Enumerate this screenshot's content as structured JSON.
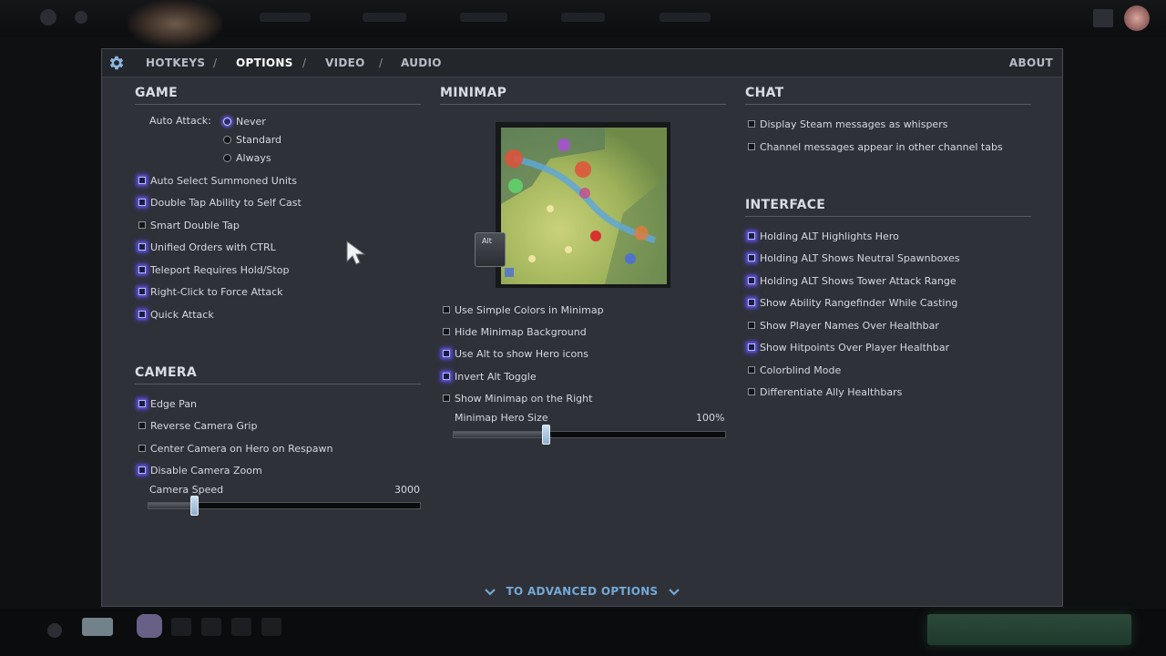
{
  "header": {
    "tabs": [
      {
        "label": "HOTKEYS",
        "active": false
      },
      {
        "label": "OPTIONS",
        "active": true
      },
      {
        "label": "VIDEO",
        "active": false
      },
      {
        "label": "AUDIO",
        "active": false
      }
    ],
    "separator": "/",
    "about_label": "ABOUT",
    "settings_icon": "gear-icon"
  },
  "game": {
    "title": "GAME",
    "auto_attack_label": "Auto Attack:",
    "auto_attack_options": [
      {
        "label": "Never",
        "selected": true
      },
      {
        "label": "Standard",
        "selected": false
      },
      {
        "label": "Always",
        "selected": false
      }
    ],
    "options": [
      {
        "label": "Auto Select Summoned Units",
        "checked": true
      },
      {
        "label": "Double Tap Ability to Self Cast",
        "checked": true
      },
      {
        "label": "Smart Double Tap",
        "checked": false
      },
      {
        "label": "Unified Orders with CTRL",
        "checked": true
      },
      {
        "label": "Teleport Requires Hold/Stop",
        "checked": true
      },
      {
        "label": "Right-Click to Force Attack",
        "checked": true
      },
      {
        "label": "Quick Attack",
        "checked": true
      }
    ]
  },
  "camera": {
    "title": "CAMERA",
    "options": [
      {
        "label": "Edge Pan",
        "checked": true
      },
      {
        "label": "Reverse Camera Grip",
        "checked": false
      },
      {
        "label": "Center Camera on Hero on Respawn",
        "checked": false
      },
      {
        "label": "Disable Camera Zoom",
        "checked": true
      }
    ],
    "speed_label": "Camera Speed",
    "speed_value": "3000",
    "speed_fraction": 0.17
  },
  "minimap": {
    "title": "MINIMAP",
    "alt_key_label": "Alt",
    "options": [
      {
        "label": "Use Simple Colors in Minimap",
        "checked": false
      },
      {
        "label": "Hide Minimap Background",
        "checked": false
      },
      {
        "label": "Use Alt to show Hero icons",
        "checked": true
      },
      {
        "label": "Invert Alt Toggle",
        "checked": true
      },
      {
        "label": "Show Minimap on the Right",
        "checked": false
      }
    ],
    "hero_size_label": "Minimap Hero Size",
    "hero_size_value": "100%",
    "hero_size_fraction": 0.34
  },
  "chat": {
    "title": "CHAT",
    "options": [
      {
        "label": "Display Steam messages as whispers",
        "checked": false
      },
      {
        "label": "Channel messages appear in other channel tabs",
        "checked": false
      }
    ]
  },
  "interface": {
    "title": "INTERFACE",
    "options": [
      {
        "label": "Holding ALT Highlights Hero",
        "checked": true
      },
      {
        "label": "Holding ALT Shows Neutral Spawnboxes",
        "checked": true
      },
      {
        "label": "Holding ALT Shows Tower Attack Range",
        "checked": true
      },
      {
        "label": "Show Ability Rangefinder While Casting",
        "checked": true
      },
      {
        "label": "Show Player Names Over Healthbar",
        "checked": false
      },
      {
        "label": "Show Hitpoints Over Player Healthbar",
        "checked": true
      },
      {
        "label": "Colorblind Mode",
        "checked": false
      },
      {
        "label": "Differentiate Ally Healthbars",
        "checked": false
      }
    ]
  },
  "footer": {
    "advanced_label": "TO ADVANCED OPTIONS"
  },
  "colors": {
    "accent": "#74a9d8",
    "checked_glow": "#6e5aff",
    "panel_bg": "#2e3137"
  }
}
